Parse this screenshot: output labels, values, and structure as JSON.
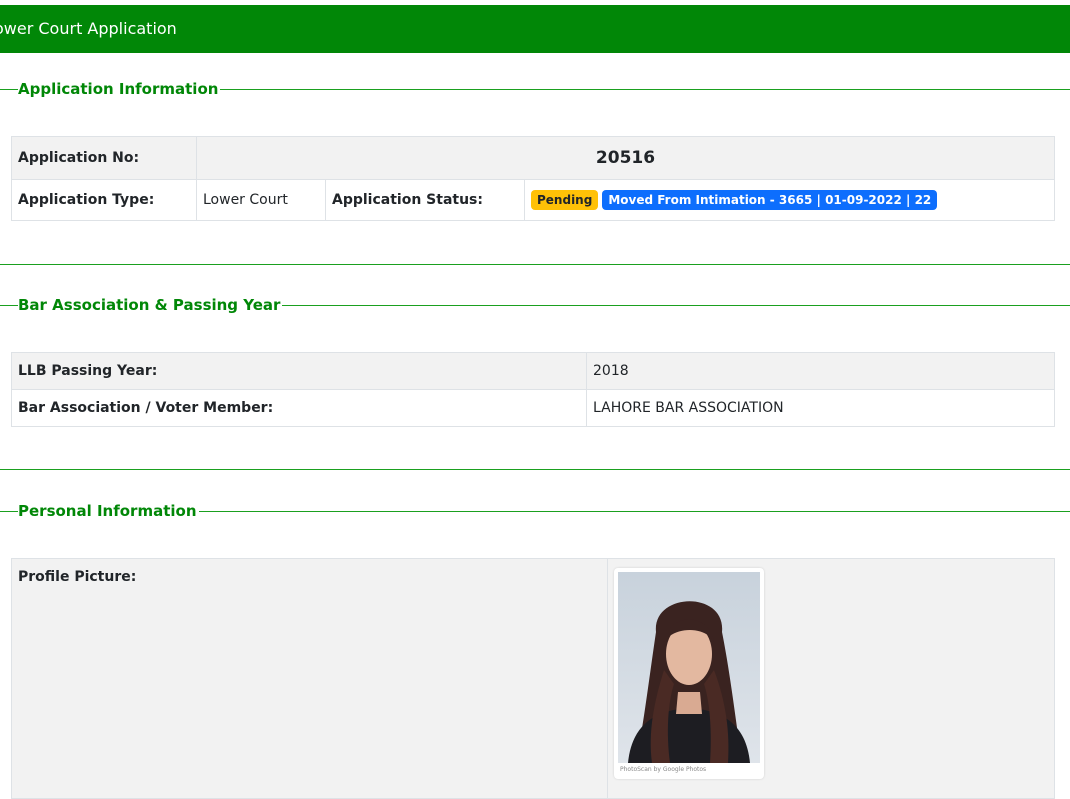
{
  "header": {
    "title": "ower Court Application"
  },
  "sections": {
    "application": "Application Information",
    "bar": "Bar Association & Passing Year",
    "personal": "Personal Information"
  },
  "application": {
    "no_label": "Application No:",
    "no_value": "20516",
    "type_label": "Application Type:",
    "type_value": "Lower Court",
    "status_label": "Application Status:",
    "status_badge": "Pending",
    "status_detail": "Moved From Intimation - 3665 | 01-09-2022 | 22"
  },
  "bar": {
    "llb_label": "LLB Passing Year:",
    "llb_value": "2018",
    "assoc_label": "Bar Association / Voter Member:",
    "assoc_value": "LAHORE BAR ASSOCIATION"
  },
  "personal": {
    "picture_label": "Profile Picture:",
    "photo_caption": "PhotoScan by Google Photos"
  },
  "colors": {
    "brand_green": "#018707",
    "badge_warning": "#ffc107",
    "badge_primary": "#0d6efd"
  }
}
